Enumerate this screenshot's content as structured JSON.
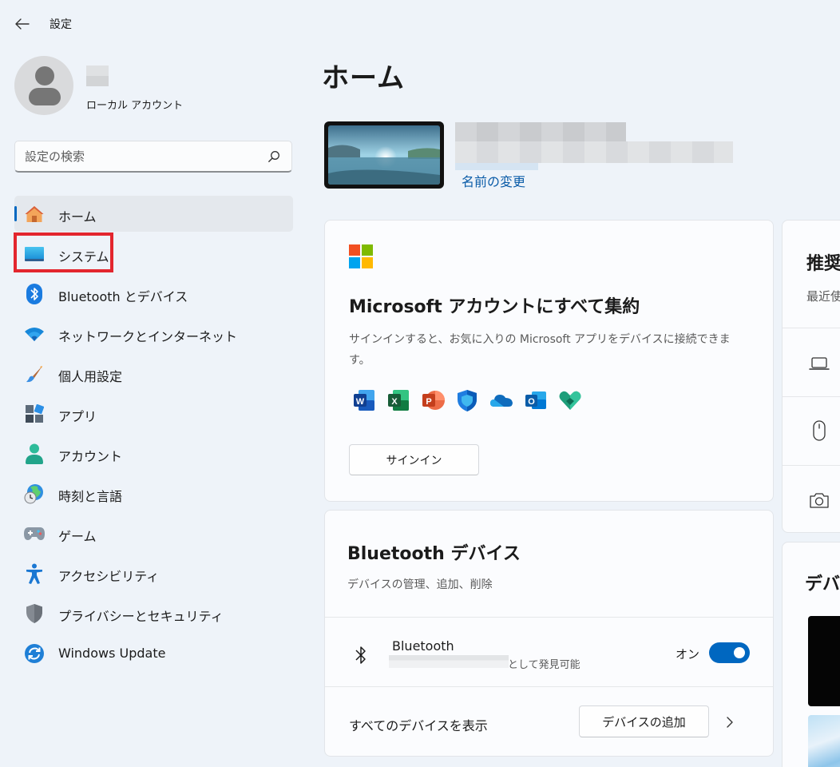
{
  "window": {
    "title": "設定"
  },
  "user": {
    "account_type": "ローカル アカウント"
  },
  "search": {
    "placeholder": "設定の検索"
  },
  "sidebar": {
    "items": [
      {
        "label": "ホーム",
        "icon": "home-icon",
        "active": true
      },
      {
        "label": "システム",
        "icon": "system-icon",
        "active": false
      },
      {
        "label": "Bluetooth とデバイス",
        "icon": "bluetooth-icon",
        "active": false
      },
      {
        "label": "ネットワークとインターネット",
        "icon": "wifi-icon",
        "active": false
      },
      {
        "label": "個人用設定",
        "icon": "brush-icon",
        "active": false
      },
      {
        "label": "アプリ",
        "icon": "apps-icon",
        "active": false
      },
      {
        "label": "アカウント",
        "icon": "account-icon",
        "active": false
      },
      {
        "label": "時刻と言語",
        "icon": "time-language-icon",
        "active": false
      },
      {
        "label": "ゲーム",
        "icon": "gamepad-icon",
        "active": false
      },
      {
        "label": "アクセシビリティ",
        "icon": "accessibility-icon",
        "active": false
      },
      {
        "label": "プライバシーとセキュリティ",
        "icon": "shield-icon",
        "active": false
      },
      {
        "label": "Windows Update",
        "icon": "windows-update-icon",
        "active": false
      }
    ]
  },
  "main": {
    "title": "ホーム",
    "rename_link": "名前の変更",
    "ms_card": {
      "title": "Microsoft アカウントにすべて集約",
      "description": "サインインすると、お気に入りの Microsoft アプリをデバイスに接続できます。",
      "signin_label": "サインイン",
      "apps": [
        "word-icon",
        "excel-icon",
        "powerpoint-icon",
        "defender-icon",
        "onedrive-icon",
        "outlook-icon",
        "family-icon"
      ]
    },
    "bt_card": {
      "title": "Bluetooth デバイス",
      "description": "デバイスの管理、追加、削除",
      "device_name": "Bluetooth",
      "discoverable_text": "として発見可能",
      "toggle_label": "オン",
      "toggle_on": true,
      "show_all_label": "すべてのデバイスを表示",
      "add_device_label": "デバイスの追加"
    },
    "rec_card": {
      "title": "推奨",
      "subtitle": "最近使"
    },
    "dev_card": {
      "title": "デバ"
    }
  },
  "colors": {
    "accent": "#0067c0",
    "highlight": "#e3262e",
    "link": "#0b5ca8"
  }
}
